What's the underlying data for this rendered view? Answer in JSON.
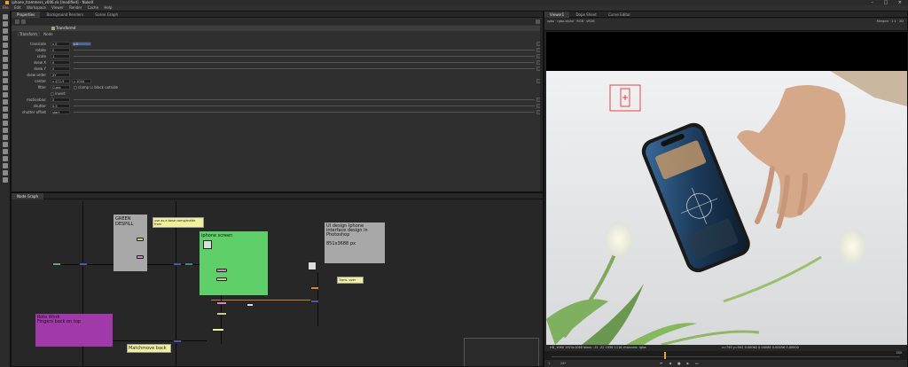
{
  "window": {
    "title": "iphone_trammers_v006.nk [modified] - NukeX",
    "controls": "–  □  ×"
  },
  "menu": [
    "File",
    "Edit",
    "Workspace",
    "Viewer",
    "Render",
    "Cache",
    "Help"
  ],
  "props_tabs": [
    {
      "label": "Properties",
      "active": true
    },
    {
      "label": "Background Renders",
      "active": false
    },
    {
      "label": "Scene Graph",
      "active": false
    }
  ],
  "node": {
    "name": "Transform4",
    "subtabs": [
      "Transform",
      "Node"
    ]
  },
  "params": [
    {
      "label": "translate",
      "field": "x 0",
      "field2": "y 0"
    },
    {
      "label": "rotate",
      "field": "0"
    },
    {
      "label": "scale",
      "field": "1"
    },
    {
      "label": "skew X",
      "field": "0"
    },
    {
      "label": "skew Y",
      "field": "0"
    },
    {
      "label": "skew order",
      "field": "XY"
    },
    {
      "label": "center",
      "field": "x 472.5",
      "field2": "y 1044"
    },
    {
      "label": "filter",
      "field": "Cubic",
      "extra": "□ clamp  ☑ black outside"
    },
    {
      "label": "",
      "field": "",
      "extra": "□ invert"
    },
    {
      "label": "motionblur",
      "field": "0"
    },
    {
      "label": "shutter",
      "field": "0.5"
    },
    {
      "label": "shutter offset",
      "field": "start"
    }
  ],
  "nodegraph": {
    "tab": "Node Graph",
    "backdrops": [
      {
        "label": "GREEN DESPILL"
      },
      {
        "label": "iphone screen"
      },
      {
        "label": "UI design Iphone interface design in Photoshop\n\n851x3688 px"
      },
      {
        "label": "Roto Work\nFingers back on top"
      }
    ],
    "sticky_notes": [
      "use as a base comp/matte from",
      "Trans. over"
    ],
    "node_label": "Matchmove back"
  },
  "viewer": {
    "tabs": [
      {
        "label": "Viewer1",
        "active": true
      },
      {
        "label": "Dope Sheet",
        "active": false
      },
      {
        "label": "Curve Editor",
        "active": false
      }
    ],
    "toolbar_left": "rgba  ·  rgba.alpha  ·  RGB  ·  sRGB",
    "toolbar_right": "Merged  ·  1:1  ·  2D",
    "info_left": "HD_1080 1920x1080  bbox: -22 -22 1936 1118 channels: rgba",
    "info_right": "x=795 y=502 0.00062  0.00085  0.00056  0.00000",
    "frame": "1",
    "fps": "24*",
    "timeline_end": "180"
  },
  "colors": {
    "accent": "#f0a030",
    "green_backdrop": "#5fcf6a",
    "purple_backdrop": "#a03aa8",
    "gray_backdrop": "#a8a8a8",
    "crosshair": "#e02020"
  }
}
